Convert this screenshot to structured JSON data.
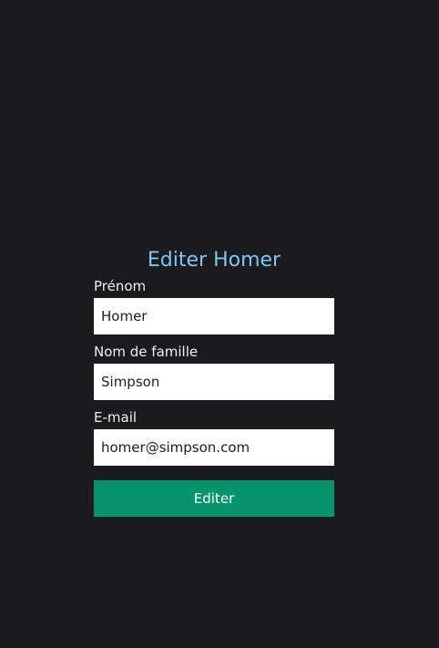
{
  "form": {
    "title": "Editer Homer",
    "fields": [
      {
        "label": "Prénom",
        "value": "Homer"
      },
      {
        "label": "Nom de famille",
        "value": "Simpson"
      },
      {
        "label": "E-mail",
        "value": "homer@simpson.com"
      }
    ],
    "submit_label": "Editer"
  },
  "colors": {
    "background": "#1b1b1d",
    "title": "#7ec4f6",
    "label": "#f0f0f0",
    "input_background": "#ffffff",
    "button_background": "#06956a",
    "button_text": "#ffffff",
    "corner_mark": "#d22d4a"
  }
}
